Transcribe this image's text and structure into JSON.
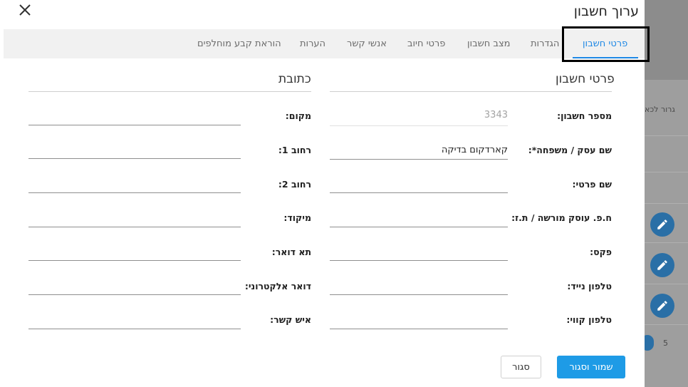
{
  "background": {
    "row_text": "גרור לכא",
    "count": "5",
    "row_icon": "pencil-icon"
  },
  "dialog": {
    "title": "ערוך חשבון",
    "close_icon": "close-icon",
    "tabs": [
      {
        "label": "פרטי חשבון",
        "active": true
      },
      {
        "label": "הגדרות"
      },
      {
        "label": "מצב חשבון"
      },
      {
        "label": "פרטי חיוב"
      },
      {
        "label": "אנשי קשר"
      },
      {
        "label": "הערות"
      },
      {
        "label": "הוראת קבע מוחלפים"
      }
    ],
    "account_section": {
      "title": "פרטי חשבון",
      "fields": [
        {
          "label": "מספר חשבון:",
          "value": "3343"
        },
        {
          "label": "שם עסק / משפחה*:",
          "value": "קארדקום בדיקה"
        },
        {
          "label": "שם פרטי:",
          "value": ""
        },
        {
          "label": "ח.פ. עוסק מורשה / ת.ז:",
          "value": ""
        },
        {
          "label": "פקס:",
          "value": ""
        },
        {
          "label": "טלפון נייד:",
          "value": ""
        },
        {
          "label": "טלפון קווי:",
          "value": ""
        }
      ]
    },
    "address_section": {
      "title": "כתובת",
      "fields": [
        {
          "label": "מקום:",
          "value": ""
        },
        {
          "label": "רחוב 1:",
          "value": ""
        },
        {
          "label": "רחוב 2:",
          "value": ""
        },
        {
          "label": "מיקוד:",
          "value": ""
        },
        {
          "label": "תא דואר:",
          "value": ""
        },
        {
          "label": "דואר אלקטרוני:",
          "value": ""
        },
        {
          "label": "איש קשר:",
          "value": ""
        }
      ]
    },
    "buttons": {
      "save_close": "שמור וסגור",
      "close": "סגור"
    },
    "colors": {
      "accent": "#1e88e5",
      "primary_button": "#1e9be6",
      "fab": "#2a6fa6"
    }
  }
}
